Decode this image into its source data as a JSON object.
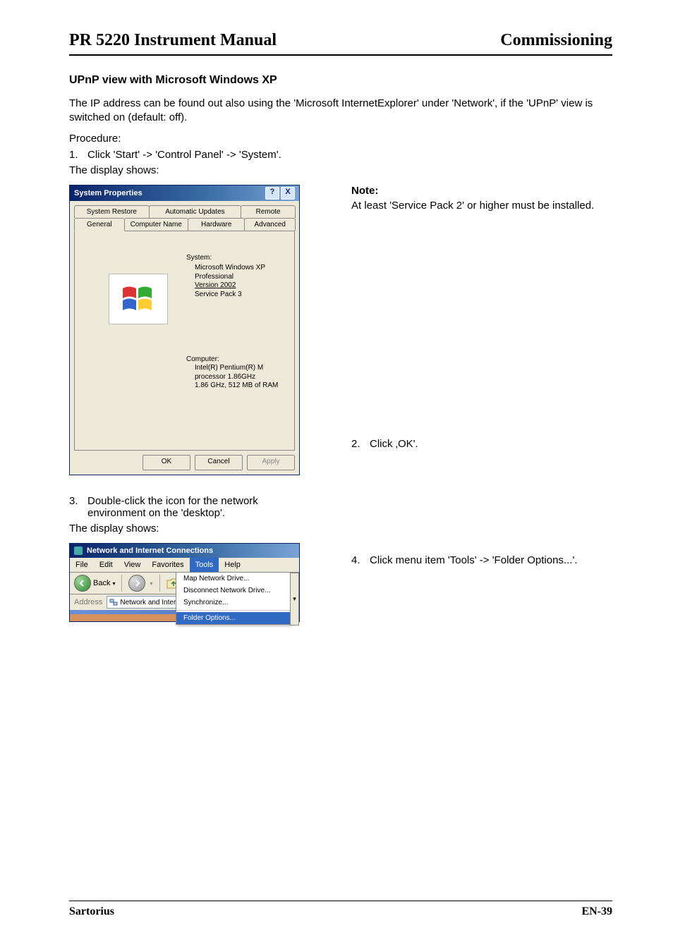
{
  "header": {
    "left": "PR 5220 Instrument Manual",
    "right": "Commissioning"
  },
  "section": {
    "subheading": "UPnP view with Microsoft Windows XP",
    "intro": "The IP address can be found out also using the 'Microsoft InternetExplorer' under 'Network', if the 'UPnP' view is switched on (default: off).",
    "procedure_label": "Procedure:",
    "step1": "Click 'Start' -> 'Control Panel' -> 'System'.",
    "display_shows": "The display shows:",
    "note_title": "Note:",
    "note_body": "At least 'Service Pack 2' or higher must be installed.",
    "step2": "Click ‚OK'.",
    "step3": "Double-click the icon for the network environment on the 'desktop'.",
    "step4": "Click menu item 'Tools' -> 'Folder Options...'."
  },
  "sp": {
    "title": "System Properties",
    "help_btn": "?",
    "close_btn": "X",
    "tabs_back": [
      "System Restore",
      "Automatic Updates",
      "Remote"
    ],
    "tabs_front": [
      "General",
      "Computer Name",
      "Hardware",
      "Advanced"
    ],
    "system_label": "System:",
    "system_lines": [
      "Microsoft Windows XP",
      "Professional",
      "Version 2002",
      "Service Pack 3"
    ],
    "version_link_index": 2,
    "computer_label": "Computer:",
    "computer_lines": [
      "Intel(R) Pentium(R) M",
      "processor 1.86GHz",
      "1.86 GHz, 512 MB of RAM"
    ],
    "buttons": {
      "ok": "OK",
      "cancel": "Cancel",
      "apply": "Apply"
    }
  },
  "nic": {
    "title": "Network and Internet Connections",
    "menus": [
      "File",
      "Edit",
      "View",
      "Favorites",
      "Tools",
      "Help"
    ],
    "active_menu_index": 4,
    "back_label": "Back",
    "dropdown": [
      "Map Network Drive...",
      "Disconnect Network Drive...",
      "Synchronize..."
    ],
    "dropdown_hover": "Folder Options...",
    "address_label": "Address",
    "address_value": "Network and Interne"
  },
  "footer": {
    "left": "Sartorius",
    "right": "EN-39"
  }
}
